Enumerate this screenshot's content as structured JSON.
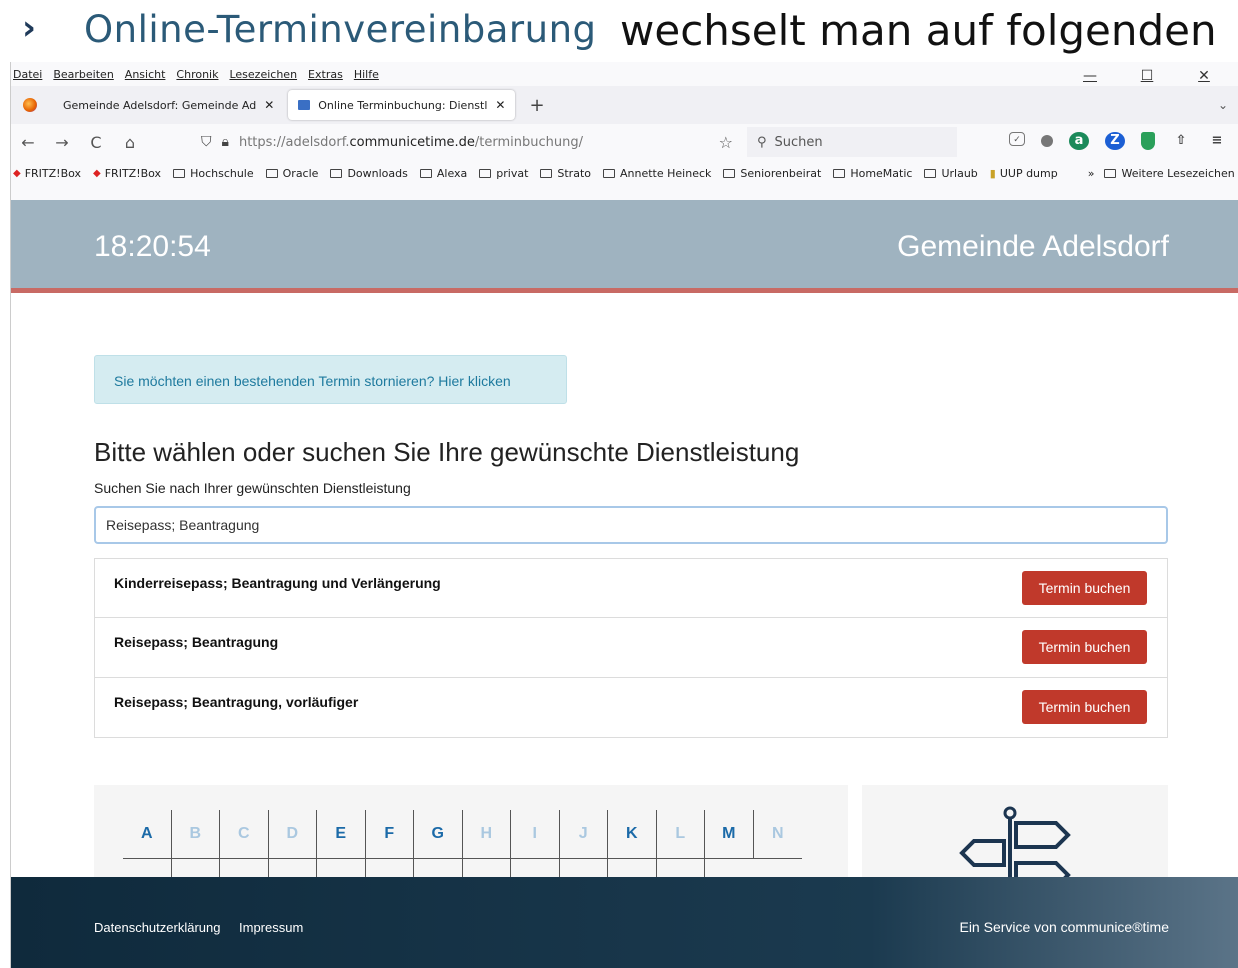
{
  "slide": {
    "chevron": "›",
    "title": "Online-Terminvereinbarung",
    "caption": "wechselt man auf folgenden"
  },
  "menu": [
    "Datei",
    "Bearbeiten",
    "Ansicht",
    "Chronik",
    "Lesezeichen",
    "Extras",
    "Hilfe"
  ],
  "window_controls": {
    "minimize": "—",
    "maximize": "☐",
    "close": "✕"
  },
  "tabs": [
    {
      "label": "Gemeinde Adelsdorf: Gemeinde Ad",
      "close": "✕"
    },
    {
      "label": "Online Terminbuchung: Dienstl",
      "close": "✕"
    }
  ],
  "new_tab": "+",
  "tab_overflow": "⌄",
  "nav": {
    "back": "←",
    "forward": "→",
    "reload": "C",
    "home": "⌂",
    "url_prefix": "https://adelsdorf.",
    "url_domain": "communicetime.de",
    "url_path": "/terminbuchung/",
    "search_placeholder": "Suchen",
    "menu": "≡"
  },
  "extensions": [
    "a",
    "Z"
  ],
  "bookmarks": [
    "FRITZ!Box",
    "FRITZ!Box",
    "Hochschule",
    "Oracle",
    "Downloads",
    "Alexa",
    "privat",
    "Strato",
    "Annette Heineck",
    "Seniorenbeirat",
    "HomeMatic",
    "Urlaub",
    "UUP dump"
  ],
  "bookmarks_more": "»",
  "bookmarks_other": "Weitere Lesezeichen",
  "header": {
    "clock": "18:20:54",
    "site_name": "Gemeinde Adelsdorf"
  },
  "cancel_text": "Sie möchten einen bestehenden Termin stornieren? Hier klicken",
  "heading": "Bitte wählen oder suchen Sie Ihre gewünschte Dienstleistung",
  "search_label": "Suchen Sie nach Ihrer gewünschten Dienstleistung",
  "search_value": "Reisepass; Beantragung",
  "results": [
    {
      "name": "Kinderreisepass; Beantragung und Verlängerung",
      "button": "Termin buchen"
    },
    {
      "name": "Reisepass; Beantragung",
      "button": "Termin buchen"
    },
    {
      "name": "Reisepass; Beantragung, vorläufiger",
      "button": "Termin buchen"
    }
  ],
  "alphabet": [
    {
      "letter": "A",
      "active": true
    },
    {
      "letter": "B",
      "active": false
    },
    {
      "letter": "C",
      "active": false
    },
    {
      "letter": "D",
      "active": false
    },
    {
      "letter": "E",
      "active": true
    },
    {
      "letter": "F",
      "active": true
    },
    {
      "letter": "G",
      "active": true
    },
    {
      "letter": "H",
      "active": false
    },
    {
      "letter": "I",
      "active": false
    },
    {
      "letter": "J",
      "active": false
    },
    {
      "letter": "K",
      "active": true
    },
    {
      "letter": "L",
      "active": false
    },
    {
      "letter": "M",
      "active": true
    },
    {
      "letter": "N",
      "active": false
    }
  ],
  "footer": {
    "privacy": "Datenschutzerklärung",
    "imprint": "Impressum",
    "service": "Ein Service von communice®time"
  },
  "colors": {
    "header_bg": "#9fb3c0",
    "accent_line": "#c86a64",
    "button": "#c0392b",
    "alert_bg": "#d5ecf1",
    "footer_bg": "#0f2a3c"
  }
}
